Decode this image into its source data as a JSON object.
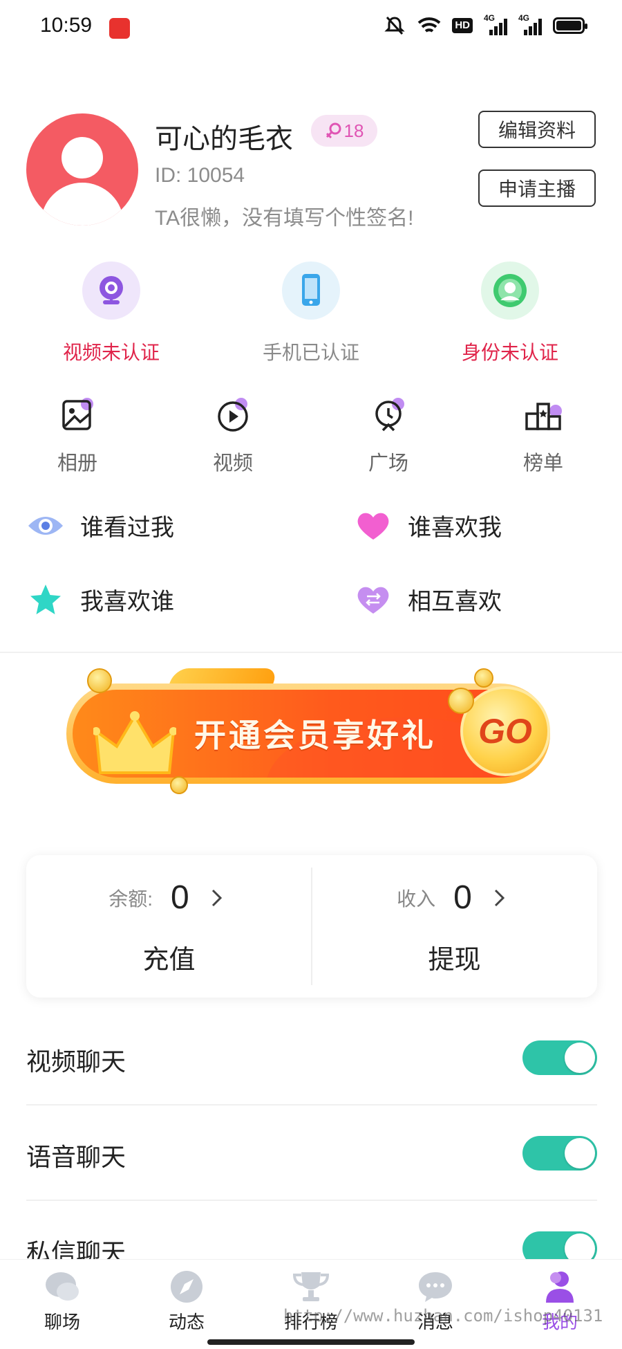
{
  "status_bar": {
    "time": "10:59",
    "hd": "HD",
    "net1": "4G",
    "net2": "4G"
  },
  "profile": {
    "nickname": "可心的毛衣",
    "age": "18",
    "id_text": "ID: 10054",
    "signature": "TA很懒，没有填写个性签名!",
    "edit_label": "编辑资料",
    "apply_label": "申请主播"
  },
  "verifications": [
    {
      "label": "视频未认证",
      "icon": "webcam-icon",
      "verified": false
    },
    {
      "label": "手机已认证",
      "icon": "phone-icon",
      "verified": true
    },
    {
      "label": "身份未认证",
      "icon": "identity-icon",
      "verified": false
    }
  ],
  "features": [
    {
      "label": "相册",
      "icon": "album-icon"
    },
    {
      "label": "视频",
      "icon": "video-play-icon"
    },
    {
      "label": "广场",
      "icon": "plaza-icon"
    },
    {
      "label": "榜单",
      "icon": "ranking-icon"
    }
  ],
  "likes": [
    {
      "label": "谁看过我",
      "icon": "eye-icon"
    },
    {
      "label": "谁喜欢我",
      "icon": "heart-icon"
    },
    {
      "label": "我喜欢谁",
      "icon": "star-icon"
    },
    {
      "label": "相互喜欢",
      "icon": "mutual-heart-icon"
    }
  ],
  "vip_banner": {
    "text": "开通会员享好礼",
    "go": "GO"
  },
  "wallet": {
    "balance_caption": "余额:",
    "balance_value": "0",
    "recharge_label": "充值",
    "income_caption": "收入",
    "income_value": "0",
    "withdraw_label": "提现"
  },
  "settings": [
    {
      "label": "视频聊天",
      "enabled": true
    },
    {
      "label": "语音聊天",
      "enabled": true
    },
    {
      "label": "私信聊天",
      "enabled": true
    }
  ],
  "tabs": [
    {
      "label": "聊场",
      "icon": "chat-square-icon",
      "active": false
    },
    {
      "label": "动态",
      "icon": "compass-icon",
      "active": false
    },
    {
      "label": "排行榜",
      "icon": "trophy-icon",
      "active": false
    },
    {
      "label": "消息",
      "icon": "message-icon",
      "active": false
    },
    {
      "label": "我的",
      "icon": "profile-icon",
      "active": true
    }
  ],
  "watermark": "http://www.huzhan.com/ishop40131",
  "colors": {
    "accent_red": "#e0244a",
    "toggle_on": "#2ec4a8",
    "tab_active": "#9a4fe6",
    "avatar_bg": "#f45b63"
  }
}
